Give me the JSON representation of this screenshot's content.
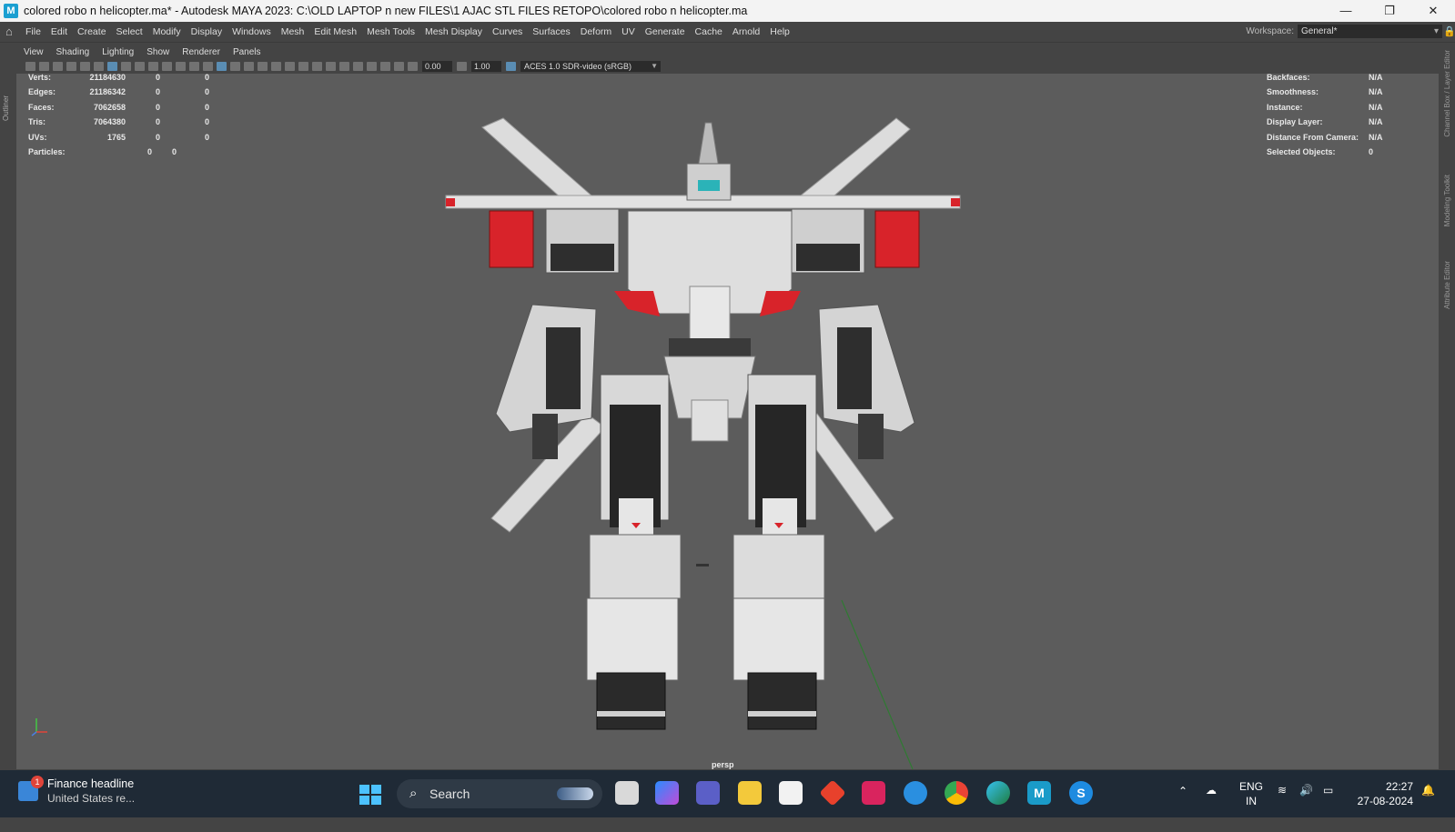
{
  "window": {
    "title": "colored robo n helicopter.ma* - Autodesk MAYA 2023: C:\\OLD LAPTOP n new FILES\\1 AJAC STL FILES RETOPO\\colored robo n helicopter.ma",
    "app_icon": "M",
    "controls": {
      "minimize": "—",
      "restore": "❐",
      "close": "✕"
    }
  },
  "menubar": {
    "items": [
      "File",
      "Edit",
      "Create",
      "Select",
      "Modify",
      "Display",
      "Windows",
      "Mesh",
      "Edit Mesh",
      "Mesh Tools",
      "Mesh Display",
      "Curves",
      "Surfaces",
      "Deform",
      "UV",
      "Generate",
      "Cache",
      "Arnold",
      "Help"
    ],
    "workspace_label": "Workspace:",
    "workspace_value": "General*"
  },
  "side_tabs": {
    "left": "Outliner",
    "right": [
      "Channel Box / Layer Editor",
      "Modeling Toolkit",
      "Attribute Editor"
    ]
  },
  "panel_menu": [
    "View",
    "Shading",
    "Lighting",
    "Show",
    "Renderer",
    "Panels"
  ],
  "panel_toolbar": {
    "exposure": "0.00",
    "gamma": "1.00",
    "color_space": "ACES 1.0 SDR-video (sRGB)"
  },
  "hud_left": [
    {
      "label": "Verts:",
      "v1": "21184630",
      "v2": "0",
      "v3": "0"
    },
    {
      "label": "Edges:",
      "v1": "21186342",
      "v2": "0",
      "v3": "0"
    },
    {
      "label": "Faces:",
      "v1": "7062658",
      "v2": "0",
      "v3": "0"
    },
    {
      "label": "Tris:",
      "v1": "7064380",
      "v2": "0",
      "v3": "0"
    },
    {
      "label": "UVs:",
      "v1": "1765",
      "v2": "0",
      "v3": "0"
    },
    {
      "label": "Particles:",
      "v1": "0",
      "v2": "0",
      "v3": ""
    }
  ],
  "hud_right": [
    {
      "label": "Backfaces:",
      "value": "N/A"
    },
    {
      "label": "Smoothness:",
      "value": "N/A"
    },
    {
      "label": "Instance:",
      "value": "N/A"
    },
    {
      "label": "Display Layer:",
      "value": "N/A"
    },
    {
      "label": "Distance From Camera:",
      "value": "N/A"
    },
    {
      "label": "Selected Objects:",
      "value": "0"
    }
  ],
  "camera_label": "persp",
  "taskbar": {
    "news_title": "Finance headline",
    "news_sub": "United States re...",
    "news_badge": "1",
    "search": "Search",
    "lang_top": "ENG",
    "lang_bottom": "IN",
    "time": "22:27",
    "date": "27-08-2024"
  },
  "colors": {
    "viewport": "#5c5c5c",
    "robot_body": "#d6d6d6",
    "robot_red": "#d8232a",
    "visor": "#2bb3b8"
  }
}
